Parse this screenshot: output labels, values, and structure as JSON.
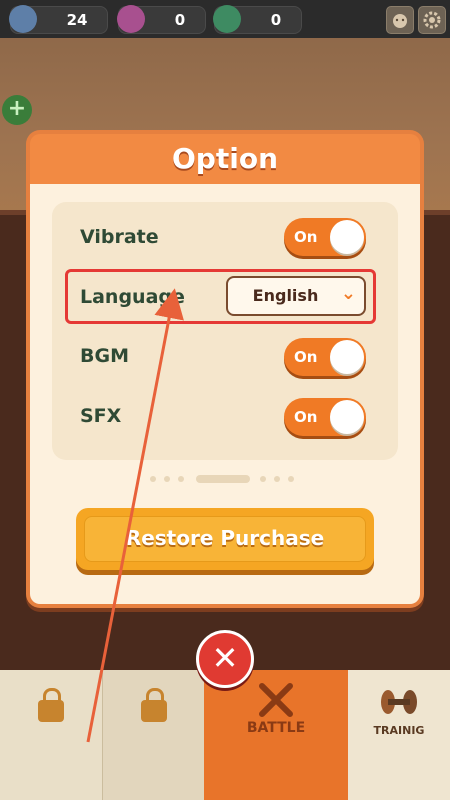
{
  "topbar": {
    "resources": [
      {
        "name": "blue-gem-icon",
        "color": "#5e7fa8",
        "value": "24"
      },
      {
        "name": "purple-gem-icon",
        "color": "#a8508f",
        "value": "0"
      },
      {
        "name": "green-gem-icon",
        "color": "#3e8b62",
        "value": "0"
      }
    ]
  },
  "dialog": {
    "title": "Option",
    "rows": {
      "vibrate": {
        "label": "Vibrate",
        "state": "On"
      },
      "language": {
        "label": "Language",
        "value": "English"
      },
      "bgm": {
        "label": "BGM",
        "state": "On"
      },
      "sfx": {
        "label": "SFX",
        "state": "On"
      }
    },
    "restore_label": "Restore Purchase"
  },
  "tabs": {
    "battle": "BATTLE",
    "training": "TRAINIG"
  },
  "colors": {
    "accent": "#f07a25",
    "annotation": "#e53935"
  }
}
